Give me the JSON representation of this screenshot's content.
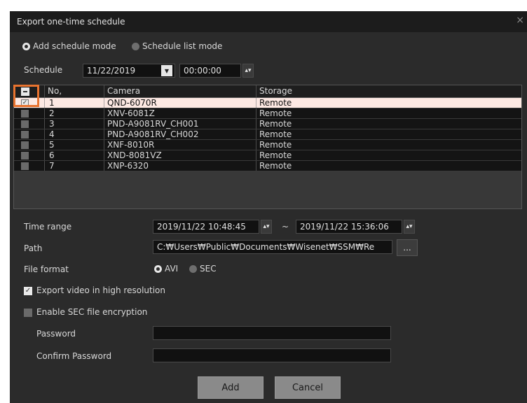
{
  "dialog": {
    "title": "Export one-time schedule",
    "close_glyph": "×"
  },
  "mode": {
    "add_label": "Add schedule mode",
    "list_label": "Schedule list mode",
    "selected": "add"
  },
  "schedule": {
    "label": "Schedule",
    "date": "11/22/2019",
    "time": "00:00:00"
  },
  "table": {
    "columns": [
      "No,",
      "Camera",
      "Storage"
    ],
    "rows": [
      {
        "no": "1",
        "camera": "QND-6070R",
        "storage": "Remote",
        "checked": true
      },
      {
        "no": "2",
        "camera": "XNV-6081Z",
        "storage": "Remote",
        "checked": false
      },
      {
        "no": "3",
        "camera": "PND-A9081RV_CH001",
        "storage": "Remote",
        "checked": false
      },
      {
        "no": "4",
        "camera": "PND-A9081RV_CH002",
        "storage": "Remote",
        "checked": false
      },
      {
        "no": "5",
        "camera": "XNF-8010R",
        "storage": "Remote",
        "checked": false
      },
      {
        "no": "6",
        "camera": "XND-8081VZ",
        "storage": "Remote",
        "checked": false
      },
      {
        "no": "7",
        "camera": "XNP-6320",
        "storage": "Remote",
        "checked": false
      }
    ]
  },
  "time_range": {
    "label": "Time range",
    "start": "2019/11/22 10:48:45",
    "separator": "~",
    "end": "2019/11/22 15:36:06"
  },
  "path": {
    "label": "Path",
    "value": "C:₩Users₩Public₩Documents₩Wisenet₩SSM₩Re",
    "browse_label": "..."
  },
  "file_format": {
    "label": "File format",
    "avi_label": "AVI",
    "sec_label": "SEC",
    "selected": "AVI"
  },
  "options": {
    "high_res_label": "Export video in high resolution",
    "high_res_checked": true,
    "encrypt_label": "Enable SEC file encryption",
    "encrypt_checked": false
  },
  "password": {
    "label": "Password",
    "confirm_label": "Confirm Password"
  },
  "buttons": {
    "add": "Add",
    "cancel": "Cancel"
  },
  "colors": {
    "highlight": "#e8732f",
    "selected_row": "#fde9e3",
    "dialog_bg": "#2b2b2b"
  }
}
